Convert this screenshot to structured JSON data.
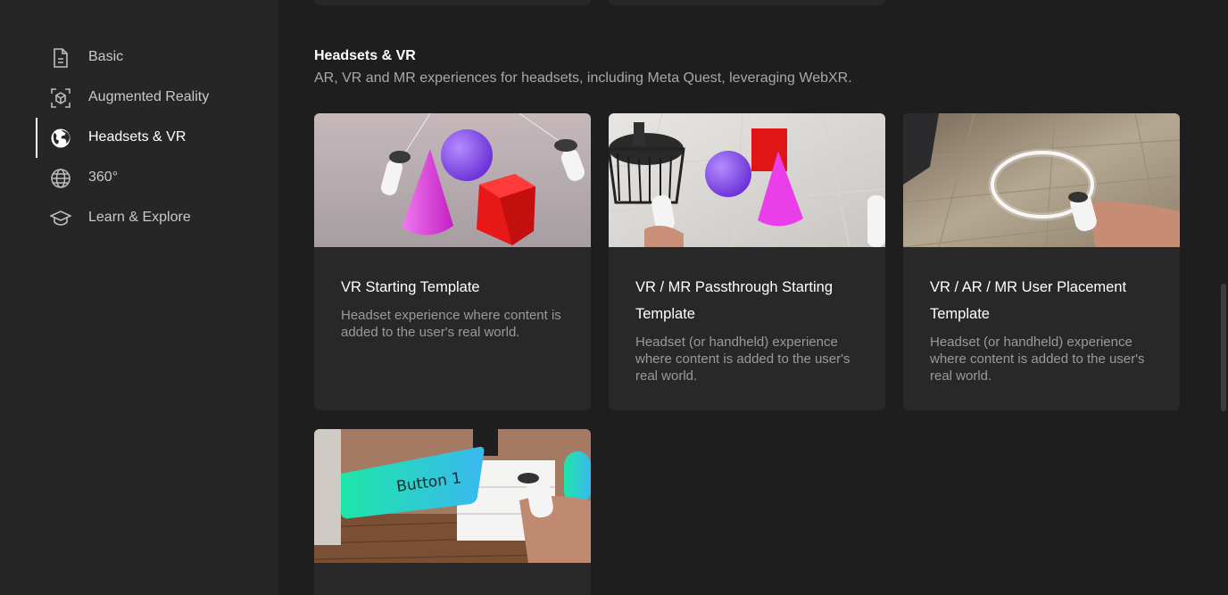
{
  "sidebar": {
    "items": [
      {
        "label": "Basic",
        "icon": "document-icon"
      },
      {
        "label": "Augmented Reality",
        "icon": "ar-cube-icon"
      },
      {
        "label": "Headsets & VR",
        "icon": "globe-filled-icon",
        "active": true
      },
      {
        "label": "360°",
        "icon": "globe-icon"
      },
      {
        "label": "Learn & Explore",
        "icon": "graduation-cap-icon"
      }
    ]
  },
  "section": {
    "title": "Headsets & VR",
    "description": "AR, VR and MR experiences for headsets, including Meta Quest, leveraging WebXR."
  },
  "cards": [
    {
      "title": "VR Starting Template",
      "description": "Headset experience where content is added to the user's real world."
    },
    {
      "title": "VR / MR Passthrough Starting Template",
      "description": "Headset (or handheld) experience where content is added to the user's real world."
    },
    {
      "title": "VR / AR / MR User Placement Template",
      "description": "Headset (or handheld) experience where content is added to the user's real world."
    },
    {
      "title": "",
      "description": "",
      "thumb_text": "Button 1"
    }
  ],
  "colors": {
    "background": "#1e1e1e",
    "sidebar": "#262626",
    "card": "#282828",
    "text_secondary": "#a8a8a8"
  }
}
